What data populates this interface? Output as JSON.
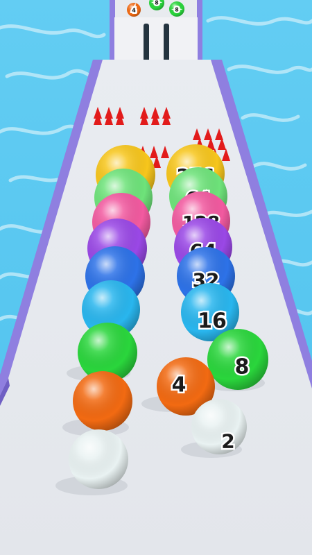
{
  "colors": {
    "water": "#5fc9f0",
    "track": "#e6e9ee",
    "rail": "#8f7fe0",
    "spike": "#e21b1b",
    "ball_yellow": "#f7c61c",
    "ball_lightgreen": "#6ee37a",
    "ball_pink": "#f25aa0",
    "ball_purple": "#9a48e6",
    "ball_blue": "#2d72e8",
    "ball_cyan": "#29b6ee",
    "ball_green": "#2ad63c",
    "ball_orange": "#f26a12",
    "ball_white": "#e9f2f2"
  },
  "balls": {
    "distant": [
      "4",
      "8",
      "8"
    ],
    "labels": [
      "2",
      "4",
      "8",
      "16",
      "32",
      "64",
      "128",
      "256"
    ]
  }
}
